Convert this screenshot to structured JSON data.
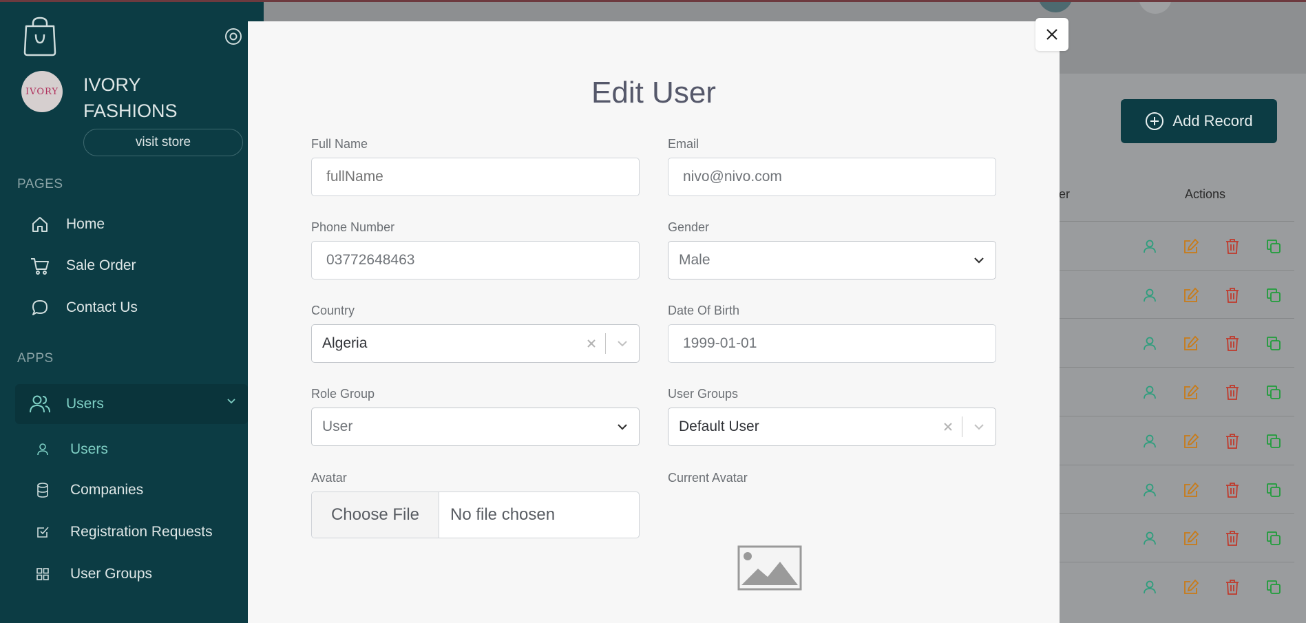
{
  "sidebar": {
    "store_name": "IVORY FASHIONS",
    "store_logo_text": "IVORY",
    "visit_store": "visit store",
    "section_pages": "PAGES",
    "section_apps": "APPS",
    "pages": [
      {
        "label": "Home",
        "icon": "home-icon"
      },
      {
        "label": "Sale Order",
        "icon": "cart-icon"
      },
      {
        "label": "Contact Us",
        "icon": "chat-icon"
      }
    ],
    "apps_group": {
      "label": "Users",
      "icon": "users-icon"
    },
    "apps_sub": [
      {
        "label": "Users",
        "icon": "user-icon"
      },
      {
        "label": "Companies",
        "icon": "database-icon"
      },
      {
        "label": "Registration Requests",
        "icon": "checkbox-icon"
      },
      {
        "label": "User Groups",
        "icon": "grid-icon"
      }
    ]
  },
  "background": {
    "add_record": "Add Record",
    "col_user_partial": "er",
    "col_actions": "Actions",
    "row_count": 8,
    "colors": {
      "view": "#2e9e7d",
      "edit": "#c97b17",
      "delete": "#c0392b",
      "copy": "#1f9d3a"
    }
  },
  "modal": {
    "title": "Edit User",
    "fields": {
      "full_name": {
        "label": "Full Name",
        "placeholder": "fullName",
        "value": ""
      },
      "email": {
        "label": "Email",
        "value": "nivo@nivo.com"
      },
      "phone": {
        "label": "Phone Number",
        "value": "03772648463"
      },
      "gender": {
        "label": "Gender",
        "value": "Male"
      },
      "country": {
        "label": "Country",
        "value": "Algeria"
      },
      "dob": {
        "label": "Date Of Birth",
        "value": "1999-01-01"
      },
      "role_group": {
        "label": "Role Group",
        "value": "User"
      },
      "user_groups": {
        "label": "User Groups",
        "value": "Default User"
      },
      "avatar": {
        "label": "Avatar",
        "button": "Choose File",
        "status": "No file chosen"
      },
      "current_avatar": {
        "label": "Current Avatar"
      }
    }
  }
}
